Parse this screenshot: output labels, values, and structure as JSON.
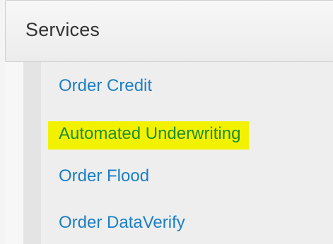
{
  "header": {
    "title": "Services"
  },
  "menu": {
    "items": [
      {
        "label": "Order Credit"
      },
      {
        "label": "Automated Underwriting",
        "highlighted": true
      },
      {
        "label": "Order Flood"
      },
      {
        "label": "Order DataVerify"
      }
    ]
  },
  "colors": {
    "link": "#1b7fc3",
    "highlight_background": "#f2f200",
    "highlight_text": "#1d8c2f",
    "header_text": "#333333"
  }
}
